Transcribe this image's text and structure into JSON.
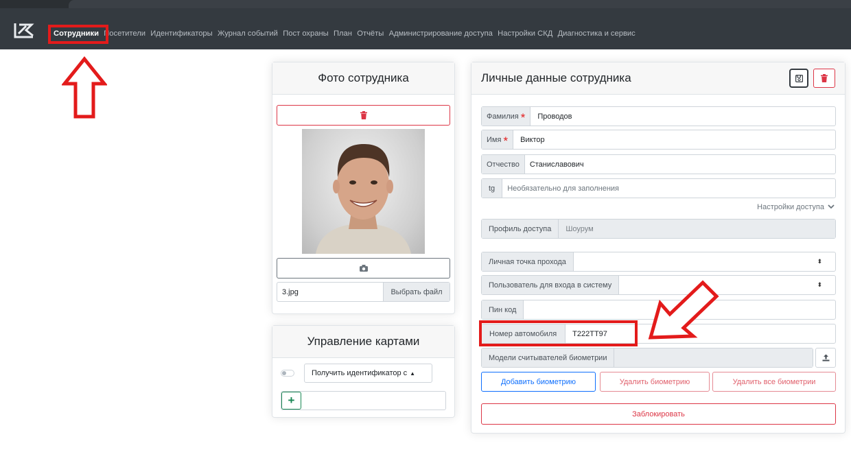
{
  "nav": {
    "items": [
      "Сотрудники",
      "Посетители",
      "Идентификаторы",
      "Журнал событий",
      "Пост охраны",
      "План",
      "Отчёты",
      "Администрирование доступа",
      "Настройки СКД",
      "Диагностика и сервис"
    ]
  },
  "photo_card": {
    "title": "Фото сотрудника",
    "file_name": "3.jpg",
    "choose_file_label": "Выбрать файл"
  },
  "cards_card": {
    "title": "Управление картами",
    "get_id_select": "Получить идентификатор с",
    "add_label": "+"
  },
  "employee": {
    "title": "Личные данные сотрудника",
    "fields": {
      "last_name_label": "Фамилия",
      "last_name": "Проводов",
      "first_name_label": "Имя",
      "first_name": "Виктор",
      "patronymic_label": "Отчество",
      "patronymic": "Станиславович",
      "tg_label": "tg",
      "tg_placeholder": "Необязательно для заполнения",
      "access_settings_link": "Настройки доступа",
      "access_profile_label": "Профиль доступа",
      "access_profile": "Шоурум",
      "personal_point_label": "Личная точка прохода",
      "personal_point": "",
      "system_user_label": "Пользователь для входа в систему",
      "system_user": "",
      "pin_label": "Пин код",
      "pin": "",
      "car_label": "Номер автомобиля",
      "car": "Т222ТТ97",
      "biometric_models_label": "Модели считывателей биометрии",
      "biometric_models": ""
    },
    "buttons": {
      "add_biometry": "Добавить биометрию",
      "delete_biometry": "Удалить биометрию",
      "delete_all_biometry": "Удалить все биометрии",
      "block": "Заблокировать"
    }
  },
  "colors": {
    "navbar": "#343a40",
    "annotation_red": "#e31b1b",
    "danger": "#dc3545",
    "primary": "#0d6efd",
    "success": "#198754"
  },
  "icons": [
    "logo-icon",
    "trash-icon",
    "camera-icon",
    "save-icon",
    "upload-icon",
    "chevron-down-icon",
    "toggle-icon",
    "select-arrows-icon",
    "arrow-up-annotation",
    "arrow-down-left-annotation"
  ]
}
